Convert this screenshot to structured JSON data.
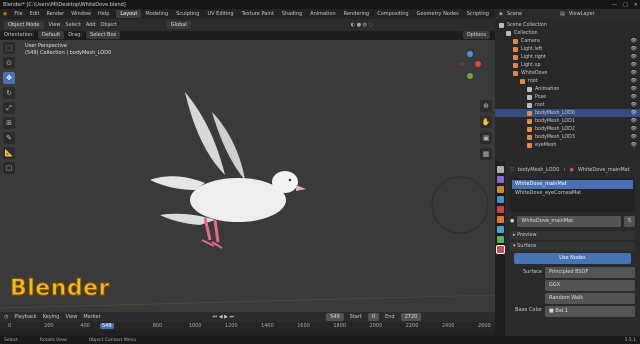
{
  "titlebar": {
    "title": "Blender* [C:\\Users\\MI\\Desktop\\WhiteDove.blend]",
    "min": "—",
    "max": "□",
    "close": "✕"
  },
  "menu": [
    "File",
    "Edit",
    "Render",
    "Window",
    "Help"
  ],
  "workspaces": [
    {
      "label": "Layout",
      "active": true
    },
    {
      "label": "Modeling",
      "active": false
    },
    {
      "label": "Sculpting",
      "active": false
    },
    {
      "label": "UV Editing",
      "active": false
    },
    {
      "label": "Texture Paint",
      "active": false
    },
    {
      "label": "Shading",
      "active": false
    },
    {
      "label": "Animation",
      "active": false
    },
    {
      "label": "Rendering",
      "active": false
    },
    {
      "label": "Compositing",
      "active": false
    },
    {
      "label": "Geometry Nodes",
      "active": false
    },
    {
      "label": "Scripting",
      "active": false
    }
  ],
  "topright": {
    "scene": "Scene",
    "viewlayer": "ViewLayer"
  },
  "viewport_header": {
    "mode": "Object Mode",
    "view": "View",
    "select": "Select",
    "add": "Add",
    "object": "Object",
    "orientation_label": "Orientation:",
    "orientation": "Default",
    "drag_label": "Drag:",
    "drag": "Select Box",
    "transform": "Global",
    "options": "Options"
  },
  "viewport_info": {
    "line1": "User Perspective",
    "line2": "(549) Collection | bodyMesh_LOD0"
  },
  "watermark": "Blender",
  "toolbar": [
    "cursor",
    "move",
    "rotate",
    "scale",
    "transform",
    "annotate",
    "measure",
    "add"
  ],
  "timeline": {
    "playback": "Playback",
    "keying": "Keying",
    "view": "View",
    "marker": "Marker",
    "current": "549",
    "start_label": "Start",
    "start": "0",
    "end_label": "End",
    "end": "2720",
    "ticks": [
      "0",
      "200",
      "400",
      "549",
      "800",
      "1000",
      "1200",
      "1400",
      "1600",
      "1800",
      "2000",
      "2200",
      "2400",
      "2600"
    ]
  },
  "status": {
    "select": "Select",
    "rotate": "Rotate View",
    "context": "Object Context Menu",
    "version": "3.5.1"
  },
  "outliner": {
    "rows": [
      {
        "label": "Scene Collection",
        "indent": 0,
        "color": "#bbbbbb"
      },
      {
        "label": "Collection",
        "indent": 1,
        "color": "#bbbbbb"
      },
      {
        "label": "Camera",
        "indent": 2,
        "color": "#e08a4a"
      },
      {
        "label": "Light.left",
        "indent": 2,
        "color": "#e08a4a"
      },
      {
        "label": "Light.right",
        "indent": 2,
        "color": "#e08a4a"
      },
      {
        "label": "Light.up",
        "indent": 2,
        "color": "#e08a4a"
      },
      {
        "label": "WhiteDove",
        "indent": 2,
        "color": "#e08a4a"
      },
      {
        "label": "root",
        "indent": 3,
        "color": "#e08a4a"
      },
      {
        "label": "Animation",
        "indent": 4,
        "color": "#bbbbbb"
      },
      {
        "label": "Pose",
        "indent": 4,
        "color": "#bbbbbb"
      },
      {
        "label": "root",
        "indent": 4,
        "color": "#bbbbbb"
      },
      {
        "label": "bodyMesh_LOD0",
        "indent": 4,
        "color": "#e08a4a"
      },
      {
        "label": "bodyMesh_LOD1",
        "indent": 4,
        "color": "#e08a4a"
      },
      {
        "label": "bodyMesh_LOD2",
        "indent": 4,
        "color": "#e08a4a"
      },
      {
        "label": "bodyMesh_LOD3",
        "indent": 4,
        "color": "#e08a4a"
      },
      {
        "label": "eyeMesh",
        "indent": 4,
        "color": "#e08a4a"
      }
    ]
  },
  "properties": {
    "breadcrumb_obj": "bodyMesh_LOD0",
    "breadcrumb_mat": "WhiteDove_mainMat",
    "slots": [
      "WhiteDove_mainMat",
      "WhiteDove_eyeCorneaMat"
    ],
    "material_name": "WhiteDove_mainMat",
    "users": "5",
    "preview": "Preview",
    "surface": "Surface",
    "use_nodes": "Use Nodes",
    "surface_label": "Surface",
    "shader": "Principled BSDF",
    "distribution": "GGX",
    "subsurface": "Random Walk",
    "base_color_label": "Base Color",
    "base_color": "■ Bal.1"
  }
}
